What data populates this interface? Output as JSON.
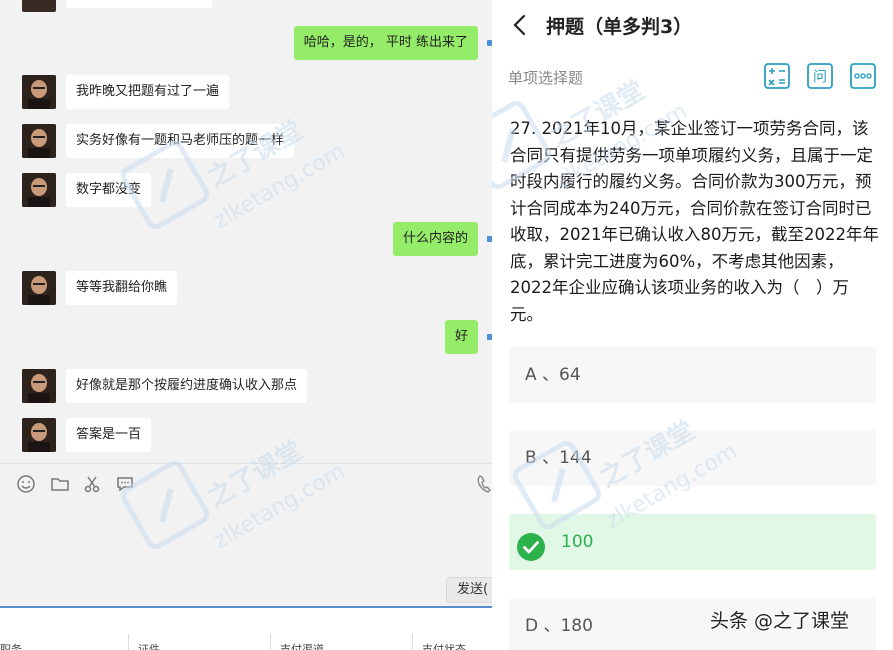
{
  "chat": {
    "messages": [
      {
        "side": "out",
        "text": "哈哈，是的， 平时 练出来了"
      },
      {
        "side": "in",
        "text": "我昨晚又把题有过了一遍"
      },
      {
        "side": "in",
        "text": "实务好像有一题和马老师压的题一样"
      },
      {
        "side": "in",
        "text": "数字都没变"
      },
      {
        "side": "out",
        "text": "什么内容的"
      },
      {
        "side": "in",
        "text": "等等我翻给你瞧"
      },
      {
        "side": "out",
        "text": "好"
      },
      {
        "side": "in",
        "text": "好像就是那个按履约进度确认收入那点"
      },
      {
        "side": "in",
        "text": "答案是一百"
      }
    ],
    "toolbar_icons": [
      "emoji-icon",
      "folder-icon",
      "scissors-icon",
      "chat-bubble-icon"
    ],
    "send_label": "发送(",
    "bottom_columns": [
      "职务",
      "证件",
      "支付渠道",
      "支付状态"
    ]
  },
  "watermark": {
    "cn": "之了课堂",
    "en": "zlketang.com"
  },
  "quiz": {
    "title": "押题（单多判3）",
    "type_label": "单项选择题",
    "header_icons": [
      "calculator-icon",
      "question-icon",
      "more-icon"
    ],
    "ask_glyph": "问",
    "question": "27. 2021年10月，某企业签订一项劳务合同，该合同只有提供劳务一项单项履约义务，且属于一定时段内履行的履约义务。合同价款为300万元，预计合同成本为240万元，合同价款在签订合同时已收取，2021年已确认收入80万元，截至2022年年底，累计完工进度为60%，不考虑其他因素，2022年企业应确认该项业务的收入为（　）万元。",
    "options": [
      {
        "label": "A 、64",
        "correct": false
      },
      {
        "label": "B 、144",
        "correct": false
      },
      {
        "label": "100",
        "correct": true
      },
      {
        "label": "D 、180",
        "correct": false
      }
    ]
  },
  "credit": "头条 @之了课堂",
  "colors": {
    "bubble_out": "#95ec69",
    "correct_green": "#2bb24c",
    "correct_bg": "#e2f8e7"
  }
}
